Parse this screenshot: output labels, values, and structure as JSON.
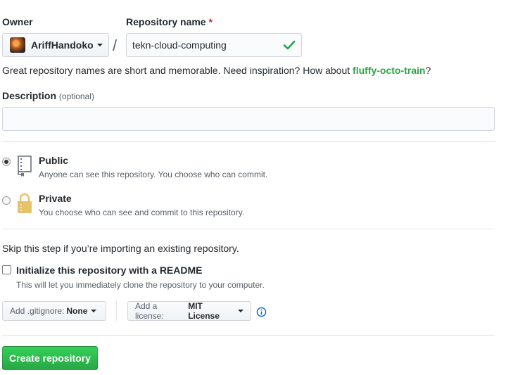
{
  "owner": {
    "label": "Owner",
    "selected": "AriffHandoko"
  },
  "repo_name": {
    "label": "Repository name",
    "required_marker": "*",
    "value": "tekn-cloud-computing",
    "slash": "/"
  },
  "suggestion": {
    "text": "Great repository names are short and memorable. Need inspiration? How about ",
    "name": "fluffy-octo-train",
    "end": "?"
  },
  "description": {
    "label": "Description",
    "optional": "(optional)",
    "value": ""
  },
  "visibility": {
    "public": {
      "title": "Public",
      "desc": "Anyone can see this repository. You choose who can commit.",
      "selected": true
    },
    "private": {
      "title": "Private",
      "desc": "You choose who can see and commit to this repository.",
      "selected": false
    }
  },
  "init": {
    "skip_note": "Skip this step if you’re importing an existing repository.",
    "readme_label": "Initialize this repository with a README",
    "readme_desc": "This will let you immediately clone the repository to your computer.",
    "readme_checked": false
  },
  "gitignore": {
    "label": "Add .gitignore:",
    "value": "None"
  },
  "license": {
    "label": "Add a license:",
    "value": "MIT License"
  },
  "create_button": "Create repository",
  "colors": {
    "accent_green": "#28a745",
    "required_red": "#cb2431",
    "info_blue": "#0366d6"
  },
  "icons": {
    "check": "check-icon",
    "repo": "repo-icon",
    "lock": "lock-icon",
    "info": "info-icon"
  }
}
